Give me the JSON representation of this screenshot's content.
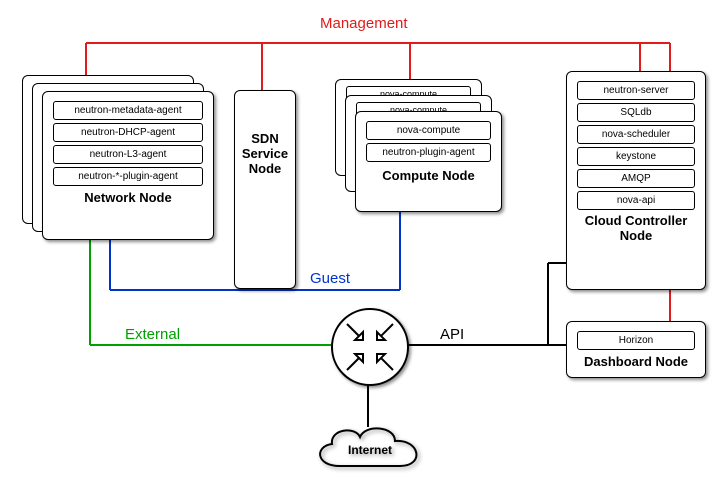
{
  "labels": {
    "management": "Management",
    "guest": "Guest",
    "external": "External",
    "api": "API",
    "internet": "Internet"
  },
  "network": {
    "title": "Network Node",
    "items": [
      "neutron-metadata-agent",
      "neutron-DHCP-agent",
      "neutron-L3-agent",
      "neutron-*-plugin-agent"
    ]
  },
  "sdn": {
    "title_line1": "SDN",
    "title_line2": "Service",
    "title_line3": "Node"
  },
  "compute": {
    "title": "Compute Node",
    "items": [
      "nova-compute",
      "neutron-plugin-agent"
    ],
    "ghost_item": "nova-compute"
  },
  "cloudctrl": {
    "title": "Cloud Controller Node",
    "items": [
      "neutron-server",
      "SQLdb",
      "nova-scheduler",
      "keystone",
      "AMQP",
      "nova-api"
    ]
  },
  "dashboard": {
    "title": "Dashboard Node",
    "items": [
      "Horizon"
    ]
  },
  "colors": {
    "management": "#e11b1b",
    "guest": "#0033cc",
    "external": "#00a000",
    "api": "#000000"
  }
}
